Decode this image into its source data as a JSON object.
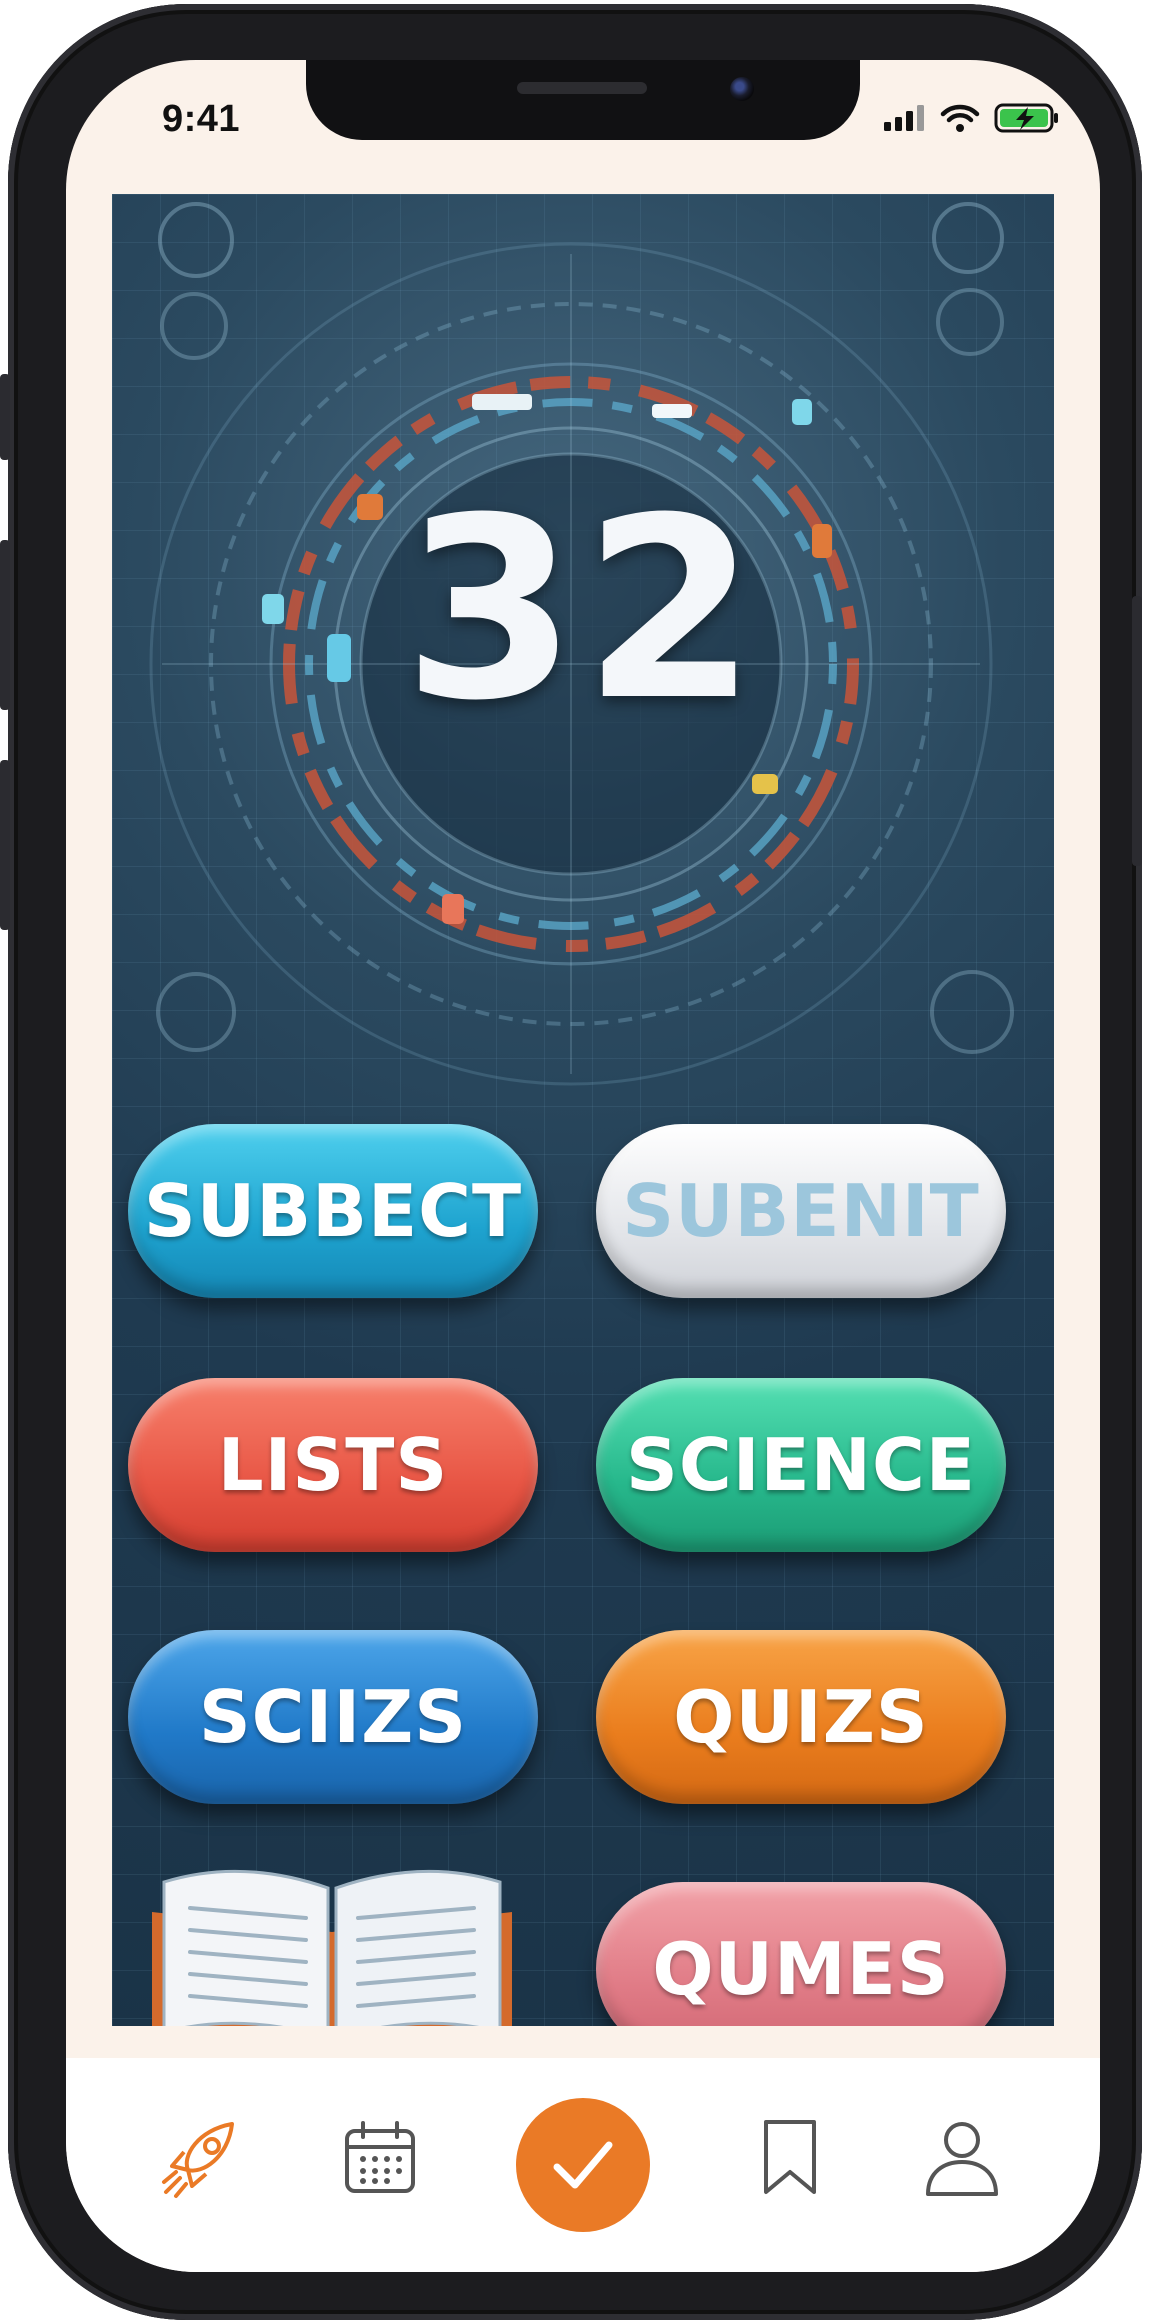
{
  "status_bar": {
    "time": "9:41"
  },
  "hero": {
    "number": "32"
  },
  "buttons": [
    {
      "label": "SUBBECT",
      "color": "#1ea3cf"
    },
    {
      "label": "SUBENIT",
      "color": "#e4e6ea"
    },
    {
      "label": "LISTS",
      "color": "#e85645"
    },
    {
      "label": "SCIENCE",
      "color": "#27b88c"
    },
    {
      "label": "SCIIZS",
      "color": "#2079c8"
    },
    {
      "label": "QUIZS",
      "color": "#ea7d1d"
    },
    {
      "label": "QUMES",
      "color": "#e07b86"
    }
  ],
  "tab_bar": {
    "items": [
      {
        "icon": "rocket-icon",
        "active": true
      },
      {
        "icon": "calendar-icon",
        "active": false
      },
      {
        "icon": "checkmark-icon",
        "active": false,
        "primary": true
      },
      {
        "icon": "bookmark-icon",
        "active": false
      },
      {
        "icon": "profile-icon",
        "active": false
      }
    ],
    "accent_color": "#ea7a26"
  }
}
